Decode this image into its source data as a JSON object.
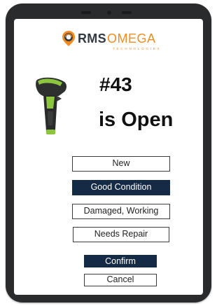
{
  "brand": {
    "name_primary": "RMS",
    "name_accent": "OMEGA",
    "tagline": "TECHNOLOGIES",
    "accent_color": "#f28c1e",
    "primary_color": "#333a44",
    "logo_icon": "location-pin-icon"
  },
  "device": {
    "image_icon": "barcode-scanner-icon",
    "number": "#43",
    "status": "is Open"
  },
  "condition_options": [
    {
      "label": "New",
      "selected": false
    },
    {
      "label": "Good Condition",
      "selected": true
    },
    {
      "label": "Damaged, Working",
      "selected": false
    },
    {
      "label": "Needs Repair",
      "selected": false
    }
  ],
  "actions": {
    "confirm_label": "Confirm",
    "cancel_label": "Cancel"
  },
  "colors": {
    "selected_fill": "#152a45",
    "tablet_frame": "#2a2b2d"
  }
}
